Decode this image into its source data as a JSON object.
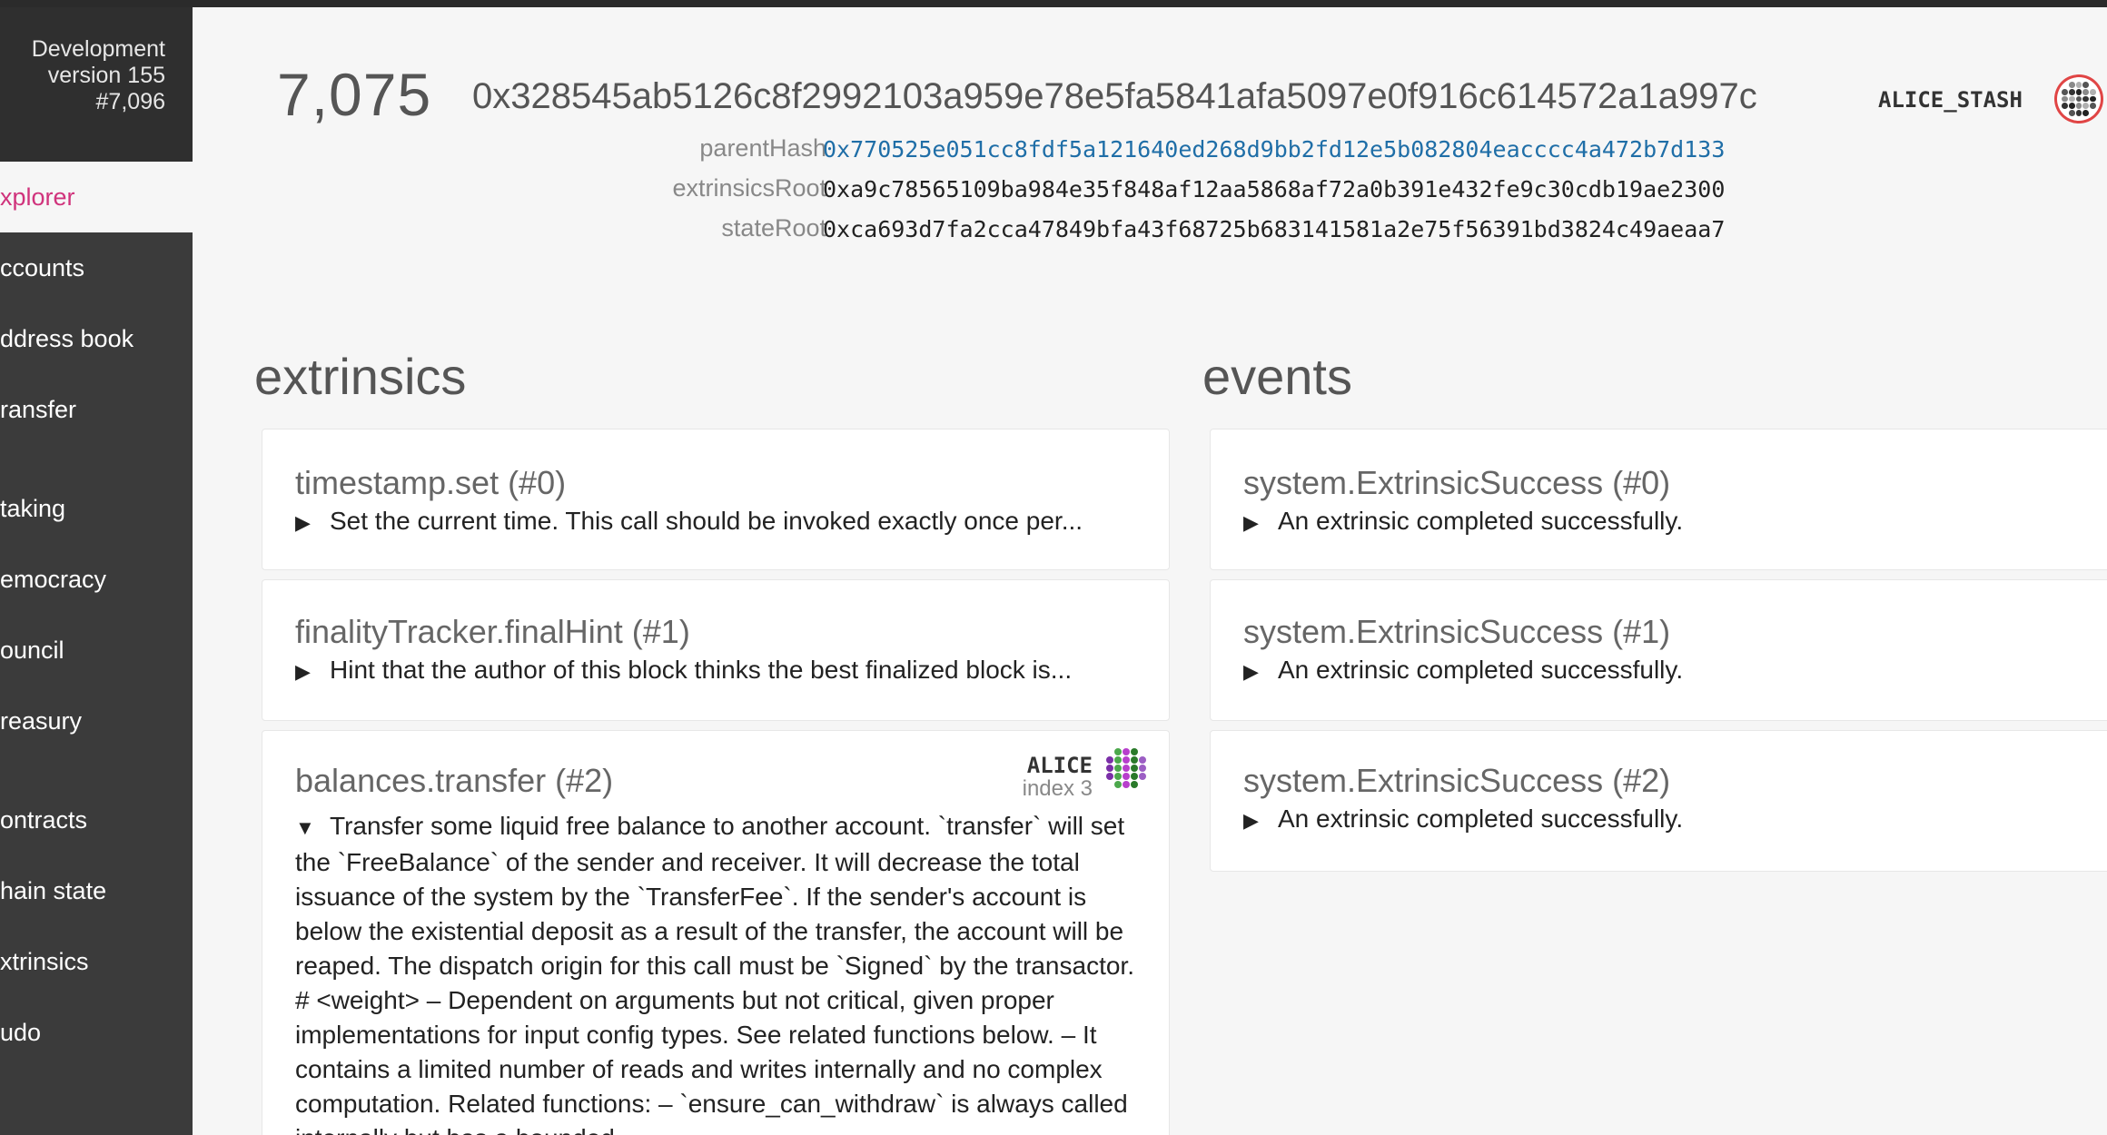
{
  "sidebar": {
    "chain": "Development",
    "version": "version 155",
    "best_block": "#7,096",
    "items": [
      {
        "label": "xplorer"
      },
      {
        "label": "ccounts"
      },
      {
        "label": "ddress book"
      },
      {
        "label": "ransfer"
      },
      {
        "label": "taking"
      },
      {
        "label": "emocracy"
      },
      {
        "label": "ouncil"
      },
      {
        "label": "reasury"
      },
      {
        "label": "ontracts"
      },
      {
        "label": "hain state"
      },
      {
        "label": "xtrinsics"
      },
      {
        "label": "udo"
      }
    ]
  },
  "block": {
    "number": "7,075",
    "hash": "0x328545ab5126c8f2992103a959e78e5fa5841afa5097e0f916c614572a1a997c",
    "author": "ALICE_STASH",
    "parent_hash_label": "parentHash",
    "parent_hash": "0x770525e051cc8fdf5a121640ed268d9bb2fd12e5b082804eacccc4a472b7d133",
    "extrinsics_root_label": "extrinsicsRoot",
    "extrinsics_root": "0xa9c78565109ba984e35f848af12aa5868af72a0b391e432fe9c30cdb19ae2300",
    "state_root_label": "stateRoot",
    "state_root": "0xca693d7fa2cca47849bfa43f68725b683141581a2e75f56391bd3824c49aeaa7"
  },
  "extrinsics": {
    "title": "extrinsics",
    "items": [
      {
        "title": "timestamp.set (#0)",
        "desc": "Set the current time. This call should be invoked exactly once per..."
      },
      {
        "title": "finalityTracker.finalHint (#1)",
        "desc": "Hint that the author of this block thinks the best finalized block is..."
      },
      {
        "title": "balances.transfer (#2)",
        "signer": "ALICE",
        "signer_index": "index 3",
        "desc": "Transfer some liquid free balance to another account. `transfer` will set the `FreeBalance` of the sender and receiver. It will decrease the total issuance of the system by the `TransferFee`. If the sender's account is below the existential deposit as a result of the transfer, the account will be reaped. The dispatch origin for this call must be `Signed` by the transactor. # <weight> – Dependent on arguments but not critical, given proper implementations for input config types. See related functions below. – It contains a limited number of reads and writes internally and no complex computation. Related functions: – `ensure_can_withdraw` is always called internally but has a bounded"
      }
    ]
  },
  "events": {
    "title": "events",
    "items": [
      {
        "title": "system.ExtrinsicSuccess (#0)",
        "desc": "An extrinsic completed successfully."
      },
      {
        "title": "system.ExtrinsicSuccess (#1)",
        "desc": "An extrinsic completed successfully."
      },
      {
        "title": "system.ExtrinsicSuccess (#2)",
        "desc": "An extrinsic completed successfully."
      }
    ]
  },
  "glyphs": {
    "collapsed": "▶",
    "expanded": "▼"
  },
  "colors": {
    "accent": "#d0337c",
    "link": "#1f6ea7",
    "sidebar": "#3b3b3b"
  },
  "icons": {
    "author_identicon": "identicon-icon",
    "signer_identicon": "identicon-icon"
  }
}
